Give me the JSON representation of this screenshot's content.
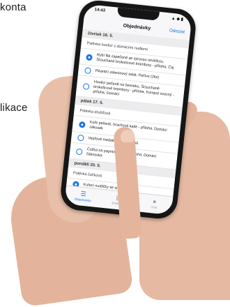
{
  "background": {
    "text_top": "konta",
    "text_mid": "likace"
  },
  "phone": {
    "status": {
      "time": "14:43",
      "icons": "▲ ◆ ▮"
    },
    "navbar": {
      "title": "Objednávky",
      "send_label": "Odeslat"
    },
    "days": [
      {
        "label": "čtvrtek 16. 5.",
        "section": "Polévka hovězí s domácími nudlemi",
        "items": [
          {
            "text": "Rybí filé zapečené se sýrovou omáčkou, Šťouchané brokolicové brambory - příloha, Čaj",
            "selected": true
          },
          {
            "text": "Pikantní zeleninový salát, Pečivo (2ks)",
            "selected": false
          },
          {
            "text": "Hovězí pečeně na česneku, Šťouchané brokolicové brambory - příloha, Kompot ovocný - příloha, Domácí",
            "selected": false
          }
        ]
      },
      {
        "label": "pátek 17. 5.",
        "section": "Polévka drožďová",
        "items": [
          {
            "text": "Kuře pečené, hrachová kaše - příloha, Domácí zákusek",
            "selected": true
          },
          {
            "text": "Vepřové medailonky s dušená",
            "selected": false
          },
          {
            "text": "Čočka na paprice, vejce - příloha, Domácí čátinovka",
            "selected": false
          }
        ]
      },
      {
        "label": "pondělí 20. 5.",
        "section": "Polévka čočková",
        "items": [
          {
            "text": "Kuřecí nudličky se smetanou",
            "selected": true
          }
        ]
      }
    ],
    "tabs": [
      {
        "label": "Objednávky",
        "icon": "list-icon",
        "glyph": "☰",
        "active": true
      },
      {
        "label": "Jídelníček",
        "icon": "menu-icon",
        "glyph": "▤",
        "active": false
      },
      {
        "label": "Účet",
        "icon": "person-icon",
        "glyph": "●",
        "active": false
      }
    ]
  }
}
